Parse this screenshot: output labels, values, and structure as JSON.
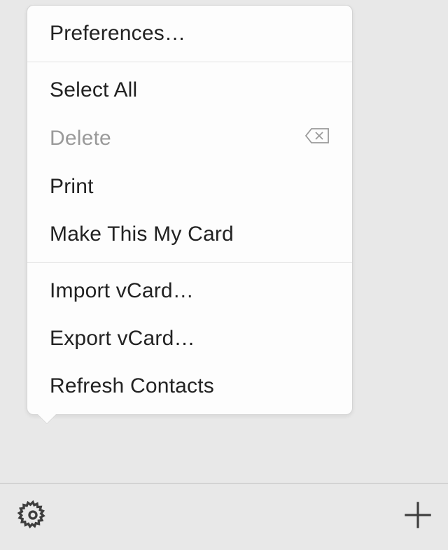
{
  "menu": {
    "preferences": "Preferences…",
    "selectAll": "Select All",
    "delete": "Delete",
    "print": "Print",
    "makeMyCard": "Make This My Card",
    "importVcard": "Import vCard…",
    "exportVcard": "Export vCard…",
    "refresh": "Refresh Contacts"
  }
}
